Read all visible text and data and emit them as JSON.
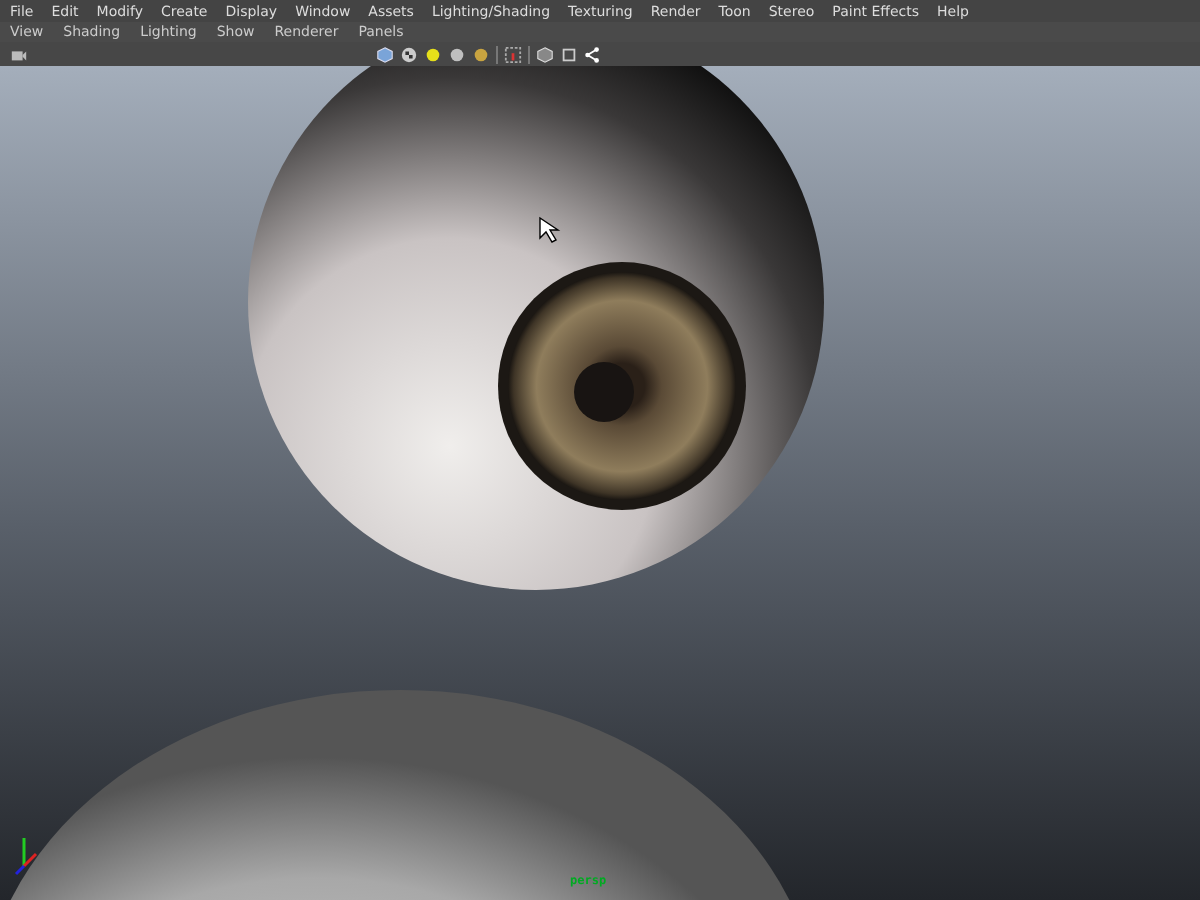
{
  "menu_bar": {
    "items": [
      "File",
      "Edit",
      "Modify",
      "Create",
      "Display",
      "Window",
      "Assets",
      "Lighting/Shading",
      "Texturing",
      "Render",
      "Toon",
      "Stereo",
      "Paint Effects",
      "Help"
    ]
  },
  "panel_menu": {
    "items": [
      "View",
      "Shading",
      "Lighting",
      "Show",
      "Renderer",
      "Panels"
    ]
  },
  "viewport": {
    "camera_label": "persp"
  }
}
